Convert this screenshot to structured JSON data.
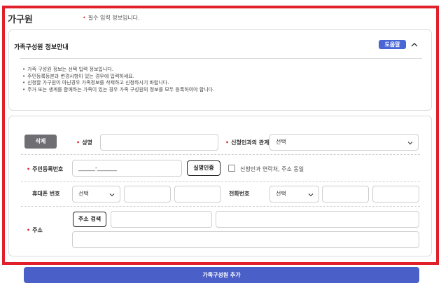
{
  "header": {
    "title": "가구원",
    "required_note": "필수 입력 정보입니다."
  },
  "info_panel": {
    "title": "가족구성원 정보안내",
    "help_label": "도움말",
    "items": [
      "가족 구성원 정보는 선택 입력 정보입니다.",
      "주민등록등본과 변경사항이 있는 경우에 입력하세요.",
      "신청할 가구원이 아닌경우 가족정보를 삭제하고 신청하시기 바랍니다.",
      "주거 또는 생계를 함께하는 가족이 있는 경우 가족 구성원의 정보를 모두 등록하여야 합니다."
    ]
  },
  "form": {
    "delete_label": "삭제",
    "name_label": "성명",
    "relation_label": "신청인과의 관계",
    "relation_select": "선택",
    "ssn_label": "주민등록번호",
    "ssn_value": "______-_______",
    "verify_label": "실명인증",
    "same_contact_label": "신청인과 연락처, 주소 동일",
    "mobile_label": "휴대폰 번호",
    "mobile_select": "선택",
    "phone_label": "전화번호",
    "phone_select": "선택",
    "address_label": "주소",
    "address_search_label": "주소 검색"
  },
  "add_member_label": "가족구성원 추가",
  "colors": {
    "accent_blue": "#4a5fc7",
    "help_blue": "#4a66d4",
    "required_red": "#d9302c",
    "highlight_frame": "#e0202a",
    "delete_gray": "#6e6e73"
  }
}
